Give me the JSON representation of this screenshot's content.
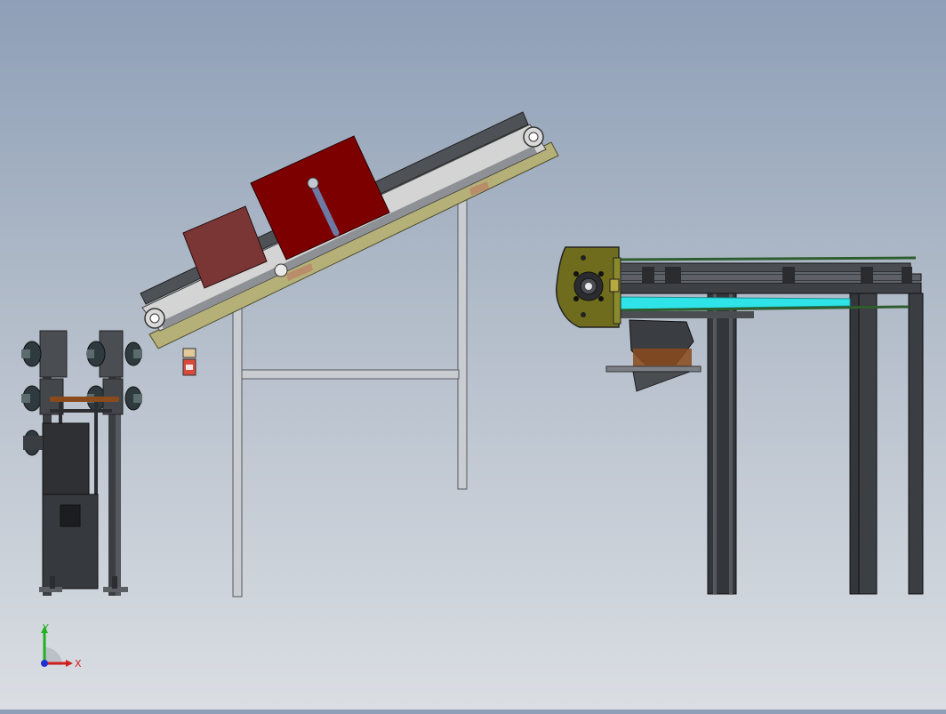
{
  "scene": {
    "background_top": "#8e9fb7",
    "background_bottom": "#dadee3",
    "colors": {
      "frame_dark": "#3a3d42",
      "frame_mid": "#6a6e74",
      "belt_light": "#d4d4d4",
      "olive": "#b5b078",
      "dark_red": "#7d0000",
      "brown_red": "#7a3535",
      "cyan": "#2fe4e8",
      "mustard": "#6f6d1d",
      "green_rail": "#2e5e2e",
      "copper": "#8a4a1c"
    }
  },
  "triad": {
    "x_label": "X",
    "y_label": "Y",
    "x_color": "#d02020",
    "y_color": "#20b020",
    "z_color": "#2030d0"
  }
}
